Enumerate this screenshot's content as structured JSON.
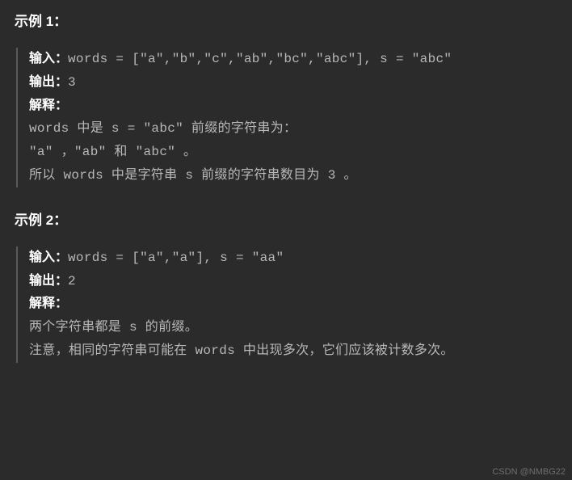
{
  "example1": {
    "heading": "示例 1：",
    "input_label": "输入：",
    "input_value": "words = [\"a\",\"b\",\"c\",\"ab\",\"bc\",\"abc\"], s = \"abc\"",
    "output_label": "输出：",
    "output_value": "3",
    "explain_label": "解释：",
    "explain_line1": "words 中是 s = \"abc\" 前缀的字符串为：",
    "explain_line2": "\"a\" ，\"ab\" 和 \"abc\" 。",
    "explain_line3": "所以 words 中是字符串 s 前缀的字符串数目为 3 。"
  },
  "example2": {
    "heading": "示例 2：",
    "input_label": "输入：",
    "input_value": "words = [\"a\",\"a\"], s = \"aa\"",
    "output_label": "输出：",
    "output_value": "2",
    "explain_label": "解释：",
    "explain_line1": "两个字符串都是 s 的前缀。",
    "explain_line2": "注意，相同的字符串可能在 words 中出现多次，它们应该被计数多次。"
  },
  "watermark": "CSDN @NMBG22"
}
